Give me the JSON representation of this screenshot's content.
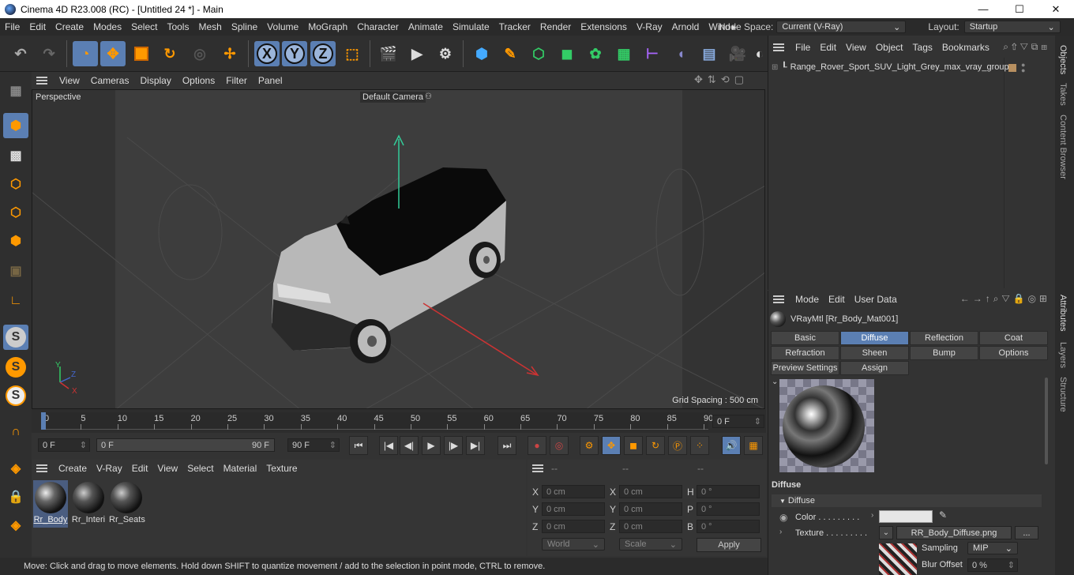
{
  "window": {
    "title": "Cinema 4D R23.008 (RC) - [Untitled 24 *] - Main",
    "minimize": "—",
    "maximize": "☐",
    "close": "✕"
  },
  "menu": [
    "File",
    "Edit",
    "Create",
    "Modes",
    "Select",
    "Tools",
    "Mesh",
    "Spline",
    "Volume",
    "MoGraph",
    "Character",
    "Animate",
    "Simulate",
    "Tracker",
    "Render",
    "Extensions",
    "V-Ray",
    "Arnold",
    "Wind"
  ],
  "menu_more": "▸",
  "node_space": {
    "label": "Node Space:",
    "value": "Current (V-Ray)"
  },
  "layout": {
    "label": "Layout:",
    "value": "Startup"
  },
  "toolbar": {
    "x": "X",
    "y": "Y",
    "z": "Z"
  },
  "viewport": {
    "menu": [
      "View",
      "Cameras",
      "Display",
      "Options",
      "Filter",
      "Panel"
    ],
    "label": "Perspective",
    "camera": "Default Camera",
    "grid_spacing": "Grid Spacing : 500 cm",
    "axis": {
      "y": "Y",
      "z": "Z",
      "x": "X"
    }
  },
  "timeline": {
    "ticks": [
      "0",
      "5",
      "10",
      "15",
      "20",
      "25",
      "30",
      "35",
      "40",
      "45",
      "50",
      "55",
      "60",
      "65",
      "70",
      "75",
      "80",
      "85",
      "90"
    ],
    "current": "0 F"
  },
  "transport": {
    "start": "0 F",
    "range_start": "0 F",
    "range_end": "90 F",
    "end": "90 F"
  },
  "material_manager": {
    "menu": [
      "Create",
      "V-Ray",
      "Edit",
      "View",
      "Select",
      "Material",
      "Texture"
    ],
    "materials": [
      {
        "name": "Rr_Body"
      },
      {
        "name": "Rr_Interi"
      },
      {
        "name": "Rr_Seats"
      }
    ]
  },
  "coordinates": {
    "header": [
      "--",
      "--",
      "--"
    ],
    "rows": [
      {
        "a": "X",
        "av": "0 cm",
        "b": "X",
        "bv": "0 cm",
        "c": "H",
        "cv": "0 °"
      },
      {
        "a": "Y",
        "av": "0 cm",
        "b": "Y",
        "bv": "0 cm",
        "c": "P",
        "cv": "0 °"
      },
      {
        "a": "Z",
        "av": "0 cm",
        "b": "Z",
        "bv": "0 cm",
        "c": "B",
        "cv": "0 °"
      }
    ],
    "mode1": "World",
    "mode2": "Scale",
    "apply": "Apply"
  },
  "status": "Move: Click and drag to move elements. Hold down SHIFT to quantize movement / add to the selection in point mode, CTRL to remove.",
  "objects": {
    "menu": [
      "File",
      "Edit",
      "View",
      "Object",
      "Tags",
      "Bookmarks"
    ],
    "items": [
      {
        "name": "Range_Rover_Sport_SUV_Light_Grey_max_vray_group"
      }
    ]
  },
  "attributes": {
    "menu": [
      "Mode",
      "Edit",
      "User Data"
    ],
    "material_title": "VRayMtl [Rr_Body_Mat001]",
    "tabs_row1": [
      "Basic",
      "Diffuse",
      "Reflection",
      "Coat"
    ],
    "tabs_row2": [
      "Refraction",
      "Sheen",
      "Bump",
      "Options"
    ],
    "tabs_row3": [
      "Preview Settings",
      "Assign"
    ],
    "active_tab": "Diffuse",
    "section": "Diffuse",
    "group": "Diffuse",
    "color_label": "Color . . . . . . . . .",
    "texture_label": "Texture . . . . . . . . .",
    "texture_file": "RR_Body_Diffuse.png",
    "more": "...",
    "sampling_label": "Sampling",
    "sampling_value": "MIP",
    "blur_label": "Blur Offset",
    "blur_value": "0 %"
  },
  "right_tabs": [
    "Objects",
    "Takes",
    "Content Browser",
    "Attributes",
    "Layers",
    "Structure"
  ]
}
